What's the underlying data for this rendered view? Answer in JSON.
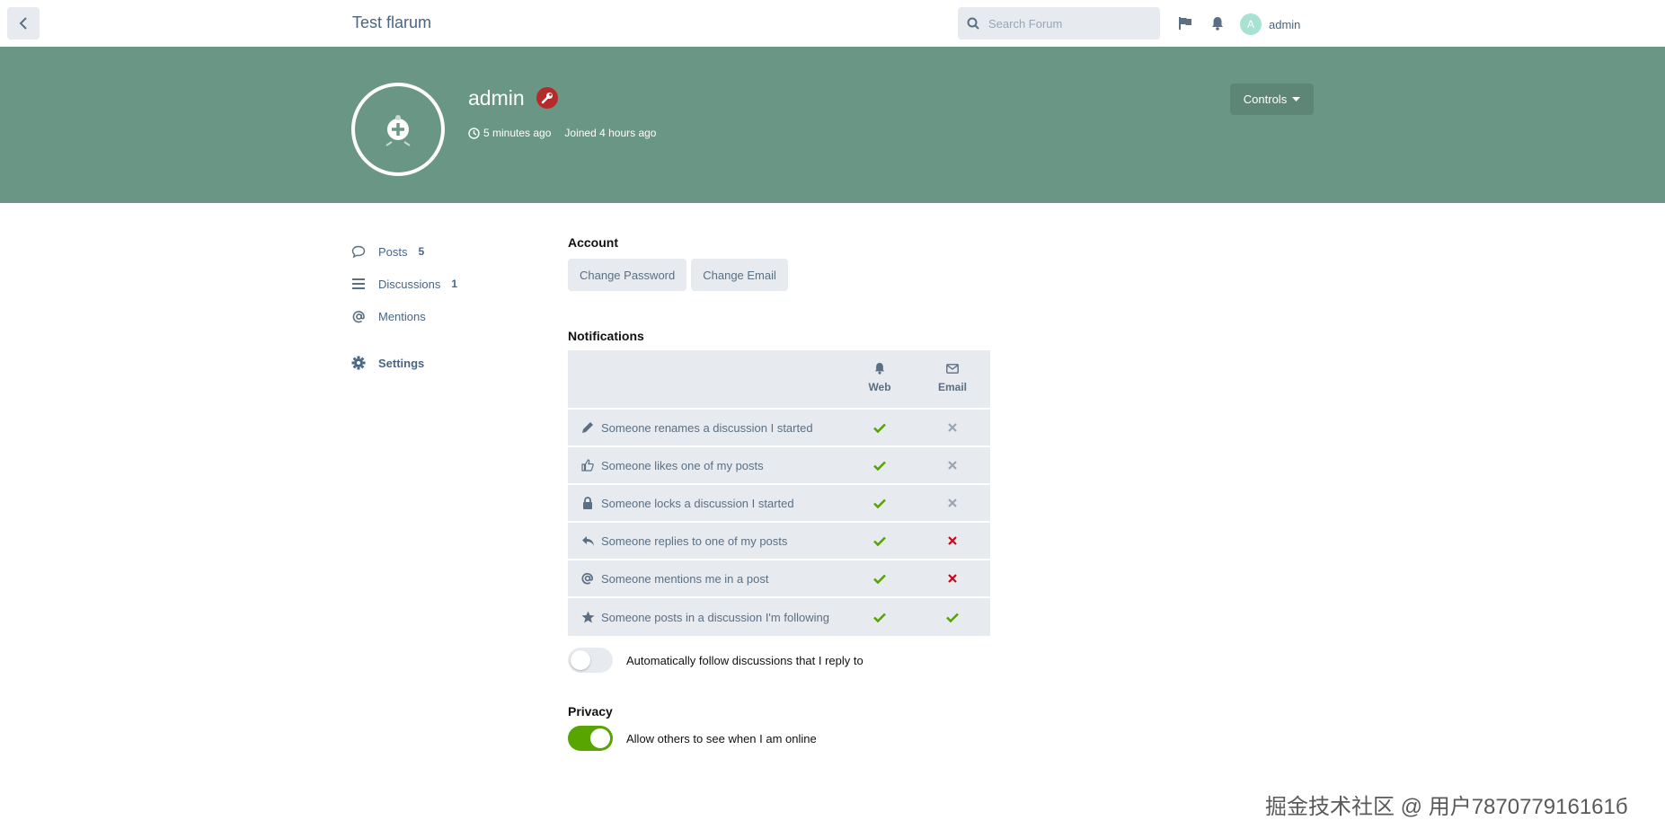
{
  "header": {
    "forum_title": "Test flarum",
    "search_placeholder": "Search Forum",
    "user": {
      "initial": "A",
      "name": "admin",
      "avatar_color": "#a7e2d2"
    }
  },
  "hero": {
    "username": "admin",
    "last_seen": "5 minutes ago",
    "joined": "Joined 4 hours ago",
    "controls_label": "Controls",
    "bg_color": "#6a9685",
    "badge_color": "#b72a2a"
  },
  "sidebar": {
    "items": [
      {
        "label": "Posts",
        "count": "5",
        "icon": "comment-icon"
      },
      {
        "label": "Discussions",
        "count": "1",
        "icon": "list-icon"
      },
      {
        "label": "Mentions",
        "count": "",
        "icon": "at-icon"
      },
      {
        "label": "Settings",
        "count": "",
        "icon": "gear-icon"
      }
    ]
  },
  "account": {
    "title": "Account",
    "change_password": "Change Password",
    "change_email": "Change Email"
  },
  "notifications": {
    "title": "Notifications",
    "col_web": "Web",
    "col_email": "Email",
    "rows": [
      {
        "label": "Someone renames a discussion I started",
        "icon": "pencil-icon",
        "web": "on",
        "email": "off"
      },
      {
        "label": "Someone likes one of my posts",
        "icon": "thumbs-up-icon",
        "web": "on",
        "email": "off"
      },
      {
        "label": "Someone locks a discussion I started",
        "icon": "lock-icon",
        "web": "on",
        "email": "off"
      },
      {
        "label": "Someone replies to one of my posts",
        "icon": "reply-icon",
        "web": "on",
        "email": "disabled"
      },
      {
        "label": "Someone mentions me in a post",
        "icon": "at-icon",
        "web": "on",
        "email": "disabled"
      },
      {
        "label": "Someone posts in a discussion I'm following",
        "icon": "star-icon",
        "web": "on",
        "email": "on"
      }
    ],
    "auto_follow_label": "Automatically follow discussions that I reply to",
    "auto_follow_on": false
  },
  "privacy": {
    "title": "Privacy",
    "online_label": "Allow others to see when I am online",
    "online_on": true
  },
  "colors": {
    "check_green": "#58a400",
    "x_gray": "#9aa5b1",
    "x_red": "#d0021b"
  },
  "watermark": "掘金技术社区 @ 用户787077916161б"
}
